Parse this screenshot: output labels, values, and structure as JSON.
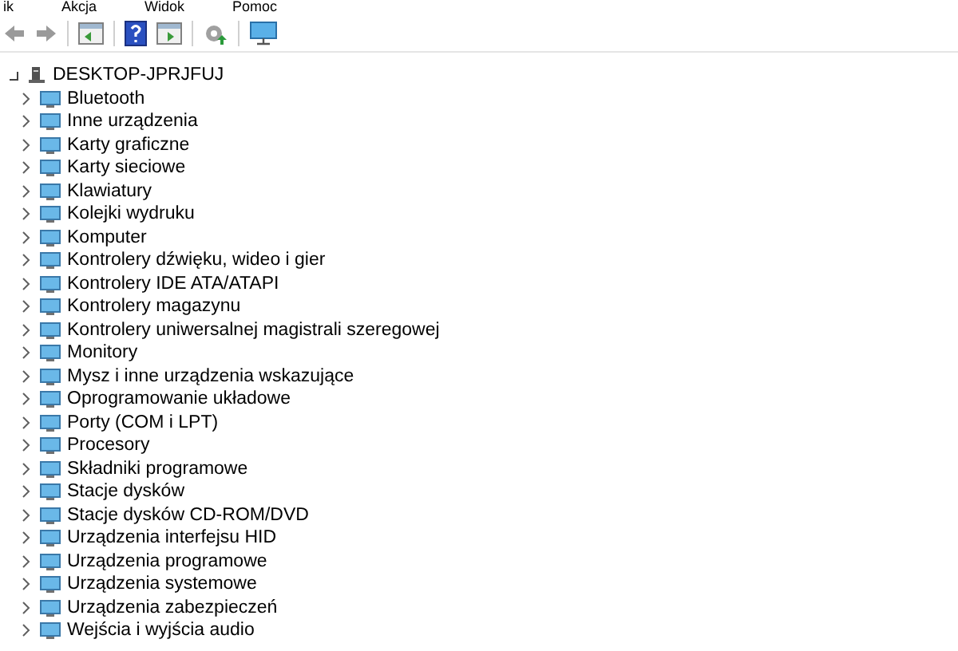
{
  "menu_bar": [
    "ik",
    "Akcja",
    "Widok",
    "Pomoc"
  ],
  "tree": {
    "label": "DESKTOP-JPRJFUJ",
    "expanded": true,
    "children": [
      {
        "label": "Bluetooth",
        "expanded": false
      },
      {
        "label": "Inne urządzenia",
        "expanded": false
      },
      {
        "label": "Karty graficzne",
        "expanded": false
      },
      {
        "label": "Karty sieciowe",
        "expanded": false
      },
      {
        "label": "Klawiatury",
        "expanded": false
      },
      {
        "label": "Kolejki wydruku",
        "expanded": false
      },
      {
        "label": "Komputer",
        "expanded": false
      },
      {
        "label": "Kontrolery dźwięku, wideo i gier",
        "expanded": false
      },
      {
        "label": "Kontrolery IDE ATA/ATAPI",
        "expanded": false
      },
      {
        "label": "Kontrolery magazynu",
        "expanded": false
      },
      {
        "label": "Kontrolery uniwersalnej magistrali szeregowej",
        "expanded": false
      },
      {
        "label": "Monitory",
        "expanded": false
      },
      {
        "label": "Mysz i inne urządzenia wskazujące",
        "expanded": false
      },
      {
        "label": "Oprogramowanie układowe",
        "expanded": false
      },
      {
        "label": "Porty (COM i LPT)",
        "expanded": false
      },
      {
        "label": "Procesory",
        "expanded": false
      },
      {
        "label": "Składniki programowe",
        "expanded": false
      },
      {
        "label": "Stacje dysków",
        "expanded": false
      },
      {
        "label": "Stacje dysków CD-ROM/DVD",
        "expanded": false
      },
      {
        "label": "Urządzenia interfejsu HID",
        "expanded": false
      },
      {
        "label": "Urządzenia programowe",
        "expanded": false
      },
      {
        "label": "Urządzenia systemowe",
        "expanded": false
      },
      {
        "label": "Urządzenia zabezpieczeń",
        "expanded": false
      },
      {
        "label": "Wejścia i wyjścia audio",
        "expanded": false
      }
    ]
  }
}
